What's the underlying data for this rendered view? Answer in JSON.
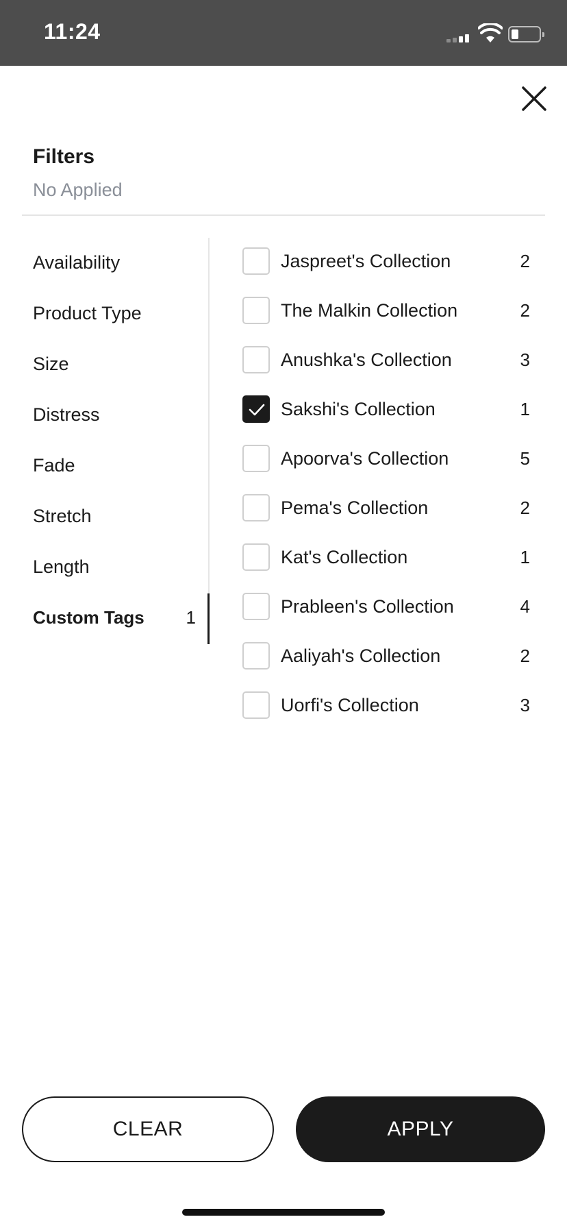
{
  "status_bar": {
    "time": "11:24"
  },
  "header": {
    "title": "Filters",
    "subtitle": "No Applied"
  },
  "categories": [
    {
      "label": "Availability",
      "count": ""
    },
    {
      "label": "Product Type",
      "count": ""
    },
    {
      "label": "Size",
      "count": ""
    },
    {
      "label": "Distress",
      "count": ""
    },
    {
      "label": "Fade",
      "count": ""
    },
    {
      "label": "Stretch",
      "count": ""
    },
    {
      "label": "Length",
      "count": ""
    },
    {
      "label": "Custom Tags",
      "count": "1"
    }
  ],
  "active_category": "Custom Tags",
  "options": [
    {
      "label": "Jaspreet's Collection",
      "count": "2",
      "checked": false
    },
    {
      "label": "The Malkin Collection",
      "count": "2",
      "checked": false
    },
    {
      "label": "Anushka's Collection",
      "count": "3",
      "checked": false
    },
    {
      "label": "Sakshi's Collection",
      "count": "1",
      "checked": true
    },
    {
      "label": "Apoorva's Collection",
      "count": "5",
      "checked": false
    },
    {
      "label": "Pema's Collection",
      "count": "2",
      "checked": false
    },
    {
      "label": "Kat's Collection",
      "count": "1",
      "checked": false
    },
    {
      "label": "Prableen's Collection",
      "count": "4",
      "checked": false
    },
    {
      "label": "Aaliyah's Collection",
      "count": "2",
      "checked": false
    },
    {
      "label": "Uorfi's Collection",
      "count": "3",
      "checked": false
    }
  ],
  "actions": {
    "clear_label": "CLEAR",
    "apply_label": "APPLY"
  },
  "colors": {
    "accent": "#1b1b1b",
    "status_bar": "#4d4d4d",
    "subtitle": "#8a8f98",
    "divider": "#e4e4e4"
  }
}
